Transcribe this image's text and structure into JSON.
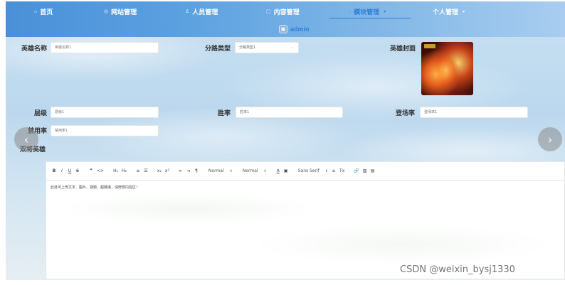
{
  "nav": {
    "items": [
      {
        "label": "首页",
        "icon": "home-icon"
      },
      {
        "label": "网站管理",
        "icon": "globe-icon"
      },
      {
        "label": "人员管理",
        "icon": "user-icon"
      },
      {
        "label": "内容管理",
        "icon": "document-icon"
      },
      {
        "label": "模块管理",
        "icon": "module-icon",
        "active": true
      },
      {
        "label": "个人管理",
        "icon": "profile-icon"
      }
    ],
    "accent": "#2f7fd8",
    "user": {
      "name": "admin",
      "avatar_icon": "avatar-icon"
    }
  },
  "form": {
    "hero_name": {
      "label": "英雄名称",
      "placeholder": "英雄名称1"
    },
    "lane_type": {
      "label": "分路类型",
      "value": "分路类型1"
    },
    "hero_cover": {
      "label": "英雄封面"
    },
    "tier": {
      "label": "层级",
      "placeholder": "层级1"
    },
    "win_rate": {
      "label": "胜率",
      "placeholder": "胜率1"
    },
    "pick_rate": {
      "label": "登场率",
      "placeholder": "登场率1"
    },
    "ban_rate": {
      "label": "禁用率",
      "placeholder": "禁用率1"
    },
    "counter_heroes": {
      "label": "双将英雄"
    }
  },
  "editor": {
    "toolbar": {
      "bold": "B",
      "italic": "I",
      "underline": "U",
      "strike": "S",
      "quote": "❞",
      "code": "<>",
      "h1": "H₁",
      "h2": "H₂",
      "ordered_list": "≡",
      "bullet_list": "☰",
      "subscript": "x₂",
      "superscript": "x²",
      "outdent": "⇤",
      "indent": "⇥",
      "direction": "¶",
      "size_select": "Normal",
      "header_select": "Normal",
      "color": "A",
      "background": "▣",
      "font_select": "Sans Serif",
      "align": "≡",
      "clean": "Tx",
      "link": "🔗",
      "image": "▧",
      "video": "▤"
    },
    "content": "此处可上传文字、图片、视频、超链接，请修尊内容区！"
  },
  "watermark": "CSDN @weixin_bysj1330"
}
